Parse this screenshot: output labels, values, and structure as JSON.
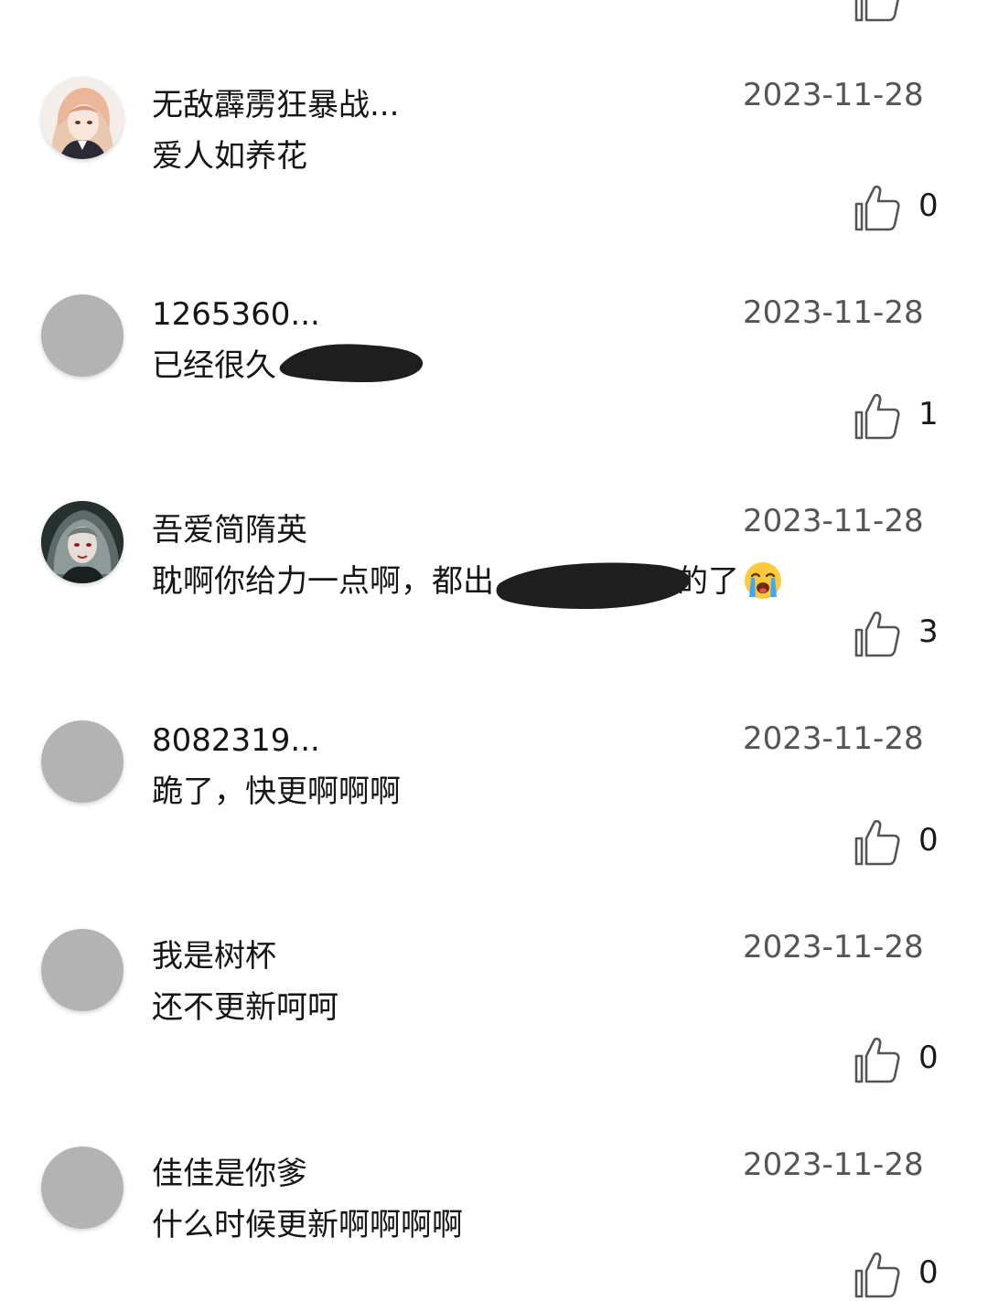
{
  "comments": [
    {
      "username": "无敌霹雳狂暴战...",
      "text": "爱人如养花",
      "date": "2023-11-28",
      "likes": "0",
      "avatar": "anime-avatar-light-hair"
    },
    {
      "username": "1265360...",
      "text": "已经很久",
      "date": "2023-11-28",
      "likes": "1",
      "avatar": "default-gray-avatar"
    },
    {
      "username": "吾爱简隋英",
      "text": "耽啊你给力一点啊，都出",
      "text_suffix": "的了",
      "date": "2023-11-28",
      "likes": "3",
      "avatar": "anime-avatar-dark-hair"
    },
    {
      "username": "8082319...",
      "text": "跪了，快更啊啊啊",
      "date": "2023-11-28",
      "likes": "0",
      "avatar": "default-gray-avatar"
    },
    {
      "username": "我是树杯",
      "text": "还不更新呵呵",
      "date": "2023-11-28",
      "likes": "0",
      "avatar": "default-gray-avatar"
    },
    {
      "username": "佳佳是你爹",
      "text": "什么时候更新啊啊啊啊",
      "date": "2023-11-28",
      "likes": "0",
      "avatar": "default-gray-avatar"
    }
  ],
  "icons": {
    "like": "thumbs-up-outline-icon",
    "emoji": "loudly-crying-face-emoji"
  },
  "colors": {
    "background": "#ffffff",
    "text": "#151515",
    "date": "#555555",
    "avatar_placeholder": "#b3b3b3",
    "icon_stroke": "#555555"
  }
}
